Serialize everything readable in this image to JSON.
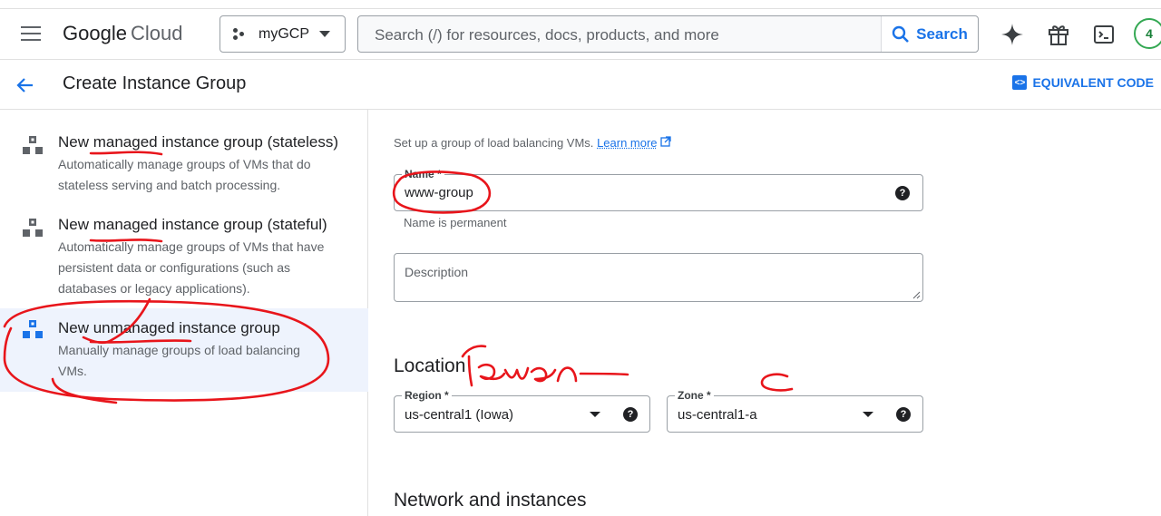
{
  "topbar": {
    "logo_google": "Google",
    "logo_cloud": "Cloud",
    "project_name": "myGCP",
    "search_placeholder": "Search (/) for resources, docs, products, and more",
    "search_button": "Search",
    "avatar_badge": "4"
  },
  "header": {
    "title": "Create Instance Group",
    "equivalent_code": "EQUIVALENT CODE"
  },
  "options": [
    {
      "title": "New managed instance group (stateless)",
      "desc": [
        "Automatically manage groups of VMs that do",
        "stateless serving and batch processing."
      ]
    },
    {
      "title": "New managed instance group (stateful)",
      "desc": [
        "Automatically manage groups of VMs that have",
        "persistent data or configurations (such as",
        "databases or legacy applications)."
      ]
    },
    {
      "title": "New unmanaged instance group",
      "desc": [
        "Manually manage groups of load balancing",
        "VMs."
      ]
    }
  ],
  "form": {
    "intro_text": "Set up a group of load balancing VMs.",
    "learn_more": "Learn more",
    "name_label": "Name *",
    "name_value": "www-group",
    "name_hint": "Name is permanent",
    "description_label": "Description",
    "location_heading": "Location",
    "region_label": "Region *",
    "region_value": "us-central1 (Iowa)",
    "zone_label": "Zone *",
    "zone_value": "us-central1-a",
    "network_heading": "Network and instances"
  },
  "colors": {
    "accent": "#1a73e8",
    "selected_bg": "#eef3fd",
    "annotation": "#e8151b"
  }
}
